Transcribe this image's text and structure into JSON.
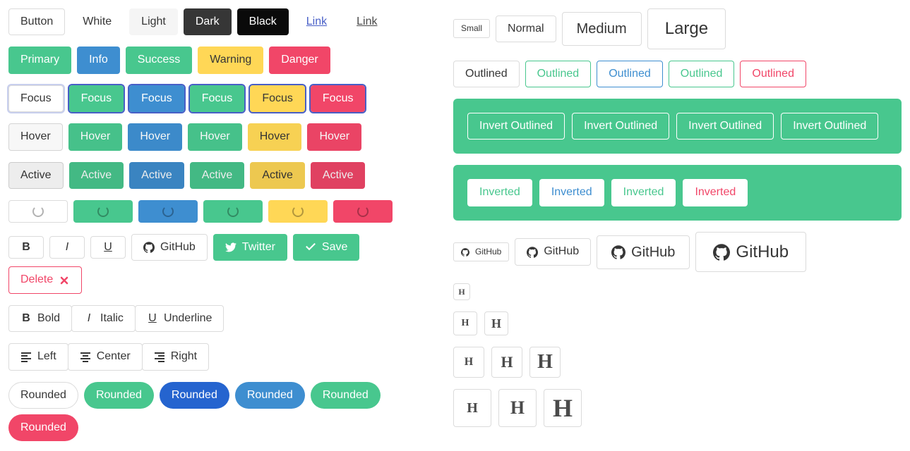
{
  "left": {
    "styles": {
      "button": "Button",
      "white": "White",
      "light": "Light",
      "dark": "Dark",
      "black": "Black",
      "link": "Link",
      "text": "Link"
    },
    "colors": {
      "primary": "Primary",
      "info": "Info",
      "success": "Success",
      "warning": "Warning",
      "danger": "Danger"
    },
    "focus": {
      "default": "Focus",
      "primary": "Focus",
      "info": "Focus",
      "success": "Focus",
      "warning": "Focus",
      "danger": "Focus"
    },
    "hover": {
      "default": "Hover",
      "primary": "Hover",
      "info": "Hover",
      "success": "Hover",
      "warning": "Hover",
      "danger": "Hover"
    },
    "active": {
      "default": "Active",
      "primary": "Active",
      "info": "Active",
      "success": "Active",
      "warning": "Active",
      "danger": "Active"
    },
    "icons": {
      "github": "GitHub",
      "twitter": "Twitter",
      "save": "Save",
      "delete": "Delete"
    },
    "format": {
      "bold": "Bold",
      "italic": "Italic",
      "underline": "Underline"
    },
    "align": {
      "left": "Left",
      "center": "Center",
      "right": "Right"
    },
    "rounded": {
      "default": "Rounded",
      "primary": "Rounded",
      "blue": "Rounded",
      "info": "Rounded",
      "success": "Rounded",
      "danger": "Rounded"
    }
  },
  "right": {
    "sizes": {
      "small": "Small",
      "normal": "Normal",
      "medium": "Medium",
      "large": "Large"
    },
    "outlined": {
      "default": "Outlined",
      "primary": "Outlined",
      "info": "Outlined",
      "success": "Outlined",
      "danger": "Outlined"
    },
    "invout": {
      "a": "Invert Outlined",
      "b": "Invert Outlined",
      "c": "Invert Outlined",
      "d": "Invert Outlined"
    },
    "inverted": {
      "primary": "Inverted",
      "info": "Inverted",
      "success": "Inverted",
      "danger": "Inverted"
    },
    "github": {
      "small": "GitHub",
      "normal": "GitHub",
      "medium": "GitHub",
      "large": "GitHub"
    }
  }
}
